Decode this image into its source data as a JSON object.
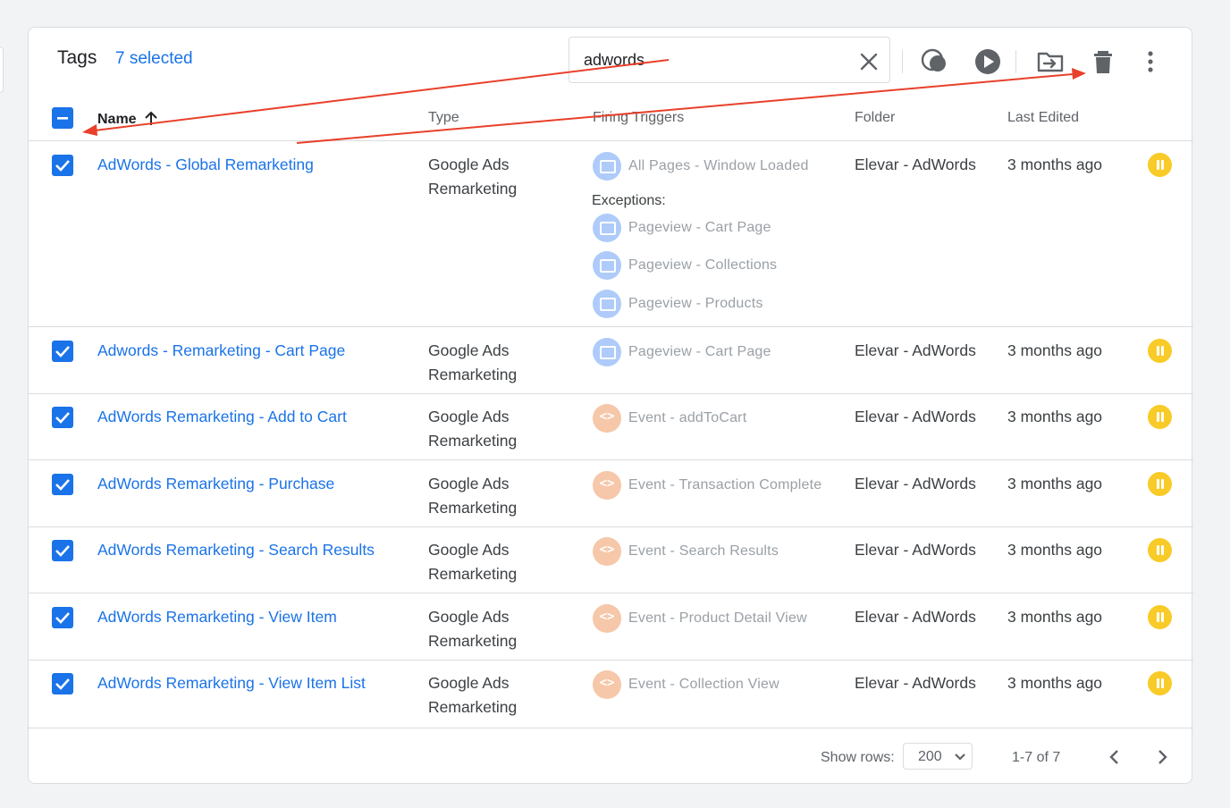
{
  "header": {
    "title": "Tags",
    "selected_label": "7 selected"
  },
  "search": {
    "value": "adwords"
  },
  "toolbar": {
    "icons": [
      "overlap-icon",
      "play-icon",
      "move-to-folder-icon",
      "delete-icon",
      "more-vert-icon"
    ]
  },
  "columns": {
    "name": "Name",
    "type": "Type",
    "firing_triggers": "Firing Triggers",
    "folder": "Folder",
    "last_edited": "Last Edited"
  },
  "rows": [
    {
      "name": "AdWords - Global Remarketing",
      "type_line1": "Google Ads",
      "type_line2": "Remarketing",
      "trigger": "All Pages - Window Loaded",
      "exceptions_label": "Exceptions:",
      "exceptions": [
        "Pageview - Cart Page",
        "Pageview - Collections",
        "Pageview - Products"
      ],
      "folder": "Elevar - AdWords",
      "last_edited": "3 months ago"
    },
    {
      "name": "Adwords - Remarketing - Cart Page",
      "type_line1": "Google Ads",
      "type_line2": "Remarketing",
      "trigger": "Pageview - Cart Page",
      "folder": "Elevar - AdWords",
      "last_edited": "3 months ago"
    },
    {
      "name": "AdWords Remarketing - Add to Cart",
      "type_line1": "Google Ads",
      "type_line2": "Remarketing",
      "trigger": "Event - addToCart",
      "folder": "Elevar - AdWords",
      "last_edited": "3 months ago"
    },
    {
      "name": "AdWords Remarketing - Purchase",
      "type_line1": "Google Ads",
      "type_line2": "Remarketing",
      "trigger": "Event - Transaction Complete",
      "folder": "Elevar - AdWords",
      "last_edited": "3 months ago"
    },
    {
      "name": "AdWords Remarketing - Search Results",
      "type_line1": "Google Ads",
      "type_line2": "Remarketing",
      "trigger": "Event - Search Results",
      "folder": "Elevar - AdWords",
      "last_edited": "3 months ago"
    },
    {
      "name": "AdWords Remarketing - View Item",
      "type_line1": "Google Ads",
      "type_line2": "Remarketing",
      "trigger": "Event - Product Detail View",
      "folder": "Elevar - AdWords",
      "last_edited": "3 months ago"
    },
    {
      "name": "AdWords Remarketing - View Item List",
      "type_line1": "Google Ads",
      "type_line2": "Remarketing",
      "trigger": "Event - Collection View",
      "folder": "Elevar - AdWords",
      "last_edited": "3 months ago"
    }
  ],
  "footer": {
    "show_rows_label": "Show rows:",
    "rows_value": "200",
    "range": "1-7 of 7"
  },
  "colors": {
    "accent": "#1a73e8",
    "pause": "#f9cb28",
    "annotation_arrow": "#e8402a"
  }
}
